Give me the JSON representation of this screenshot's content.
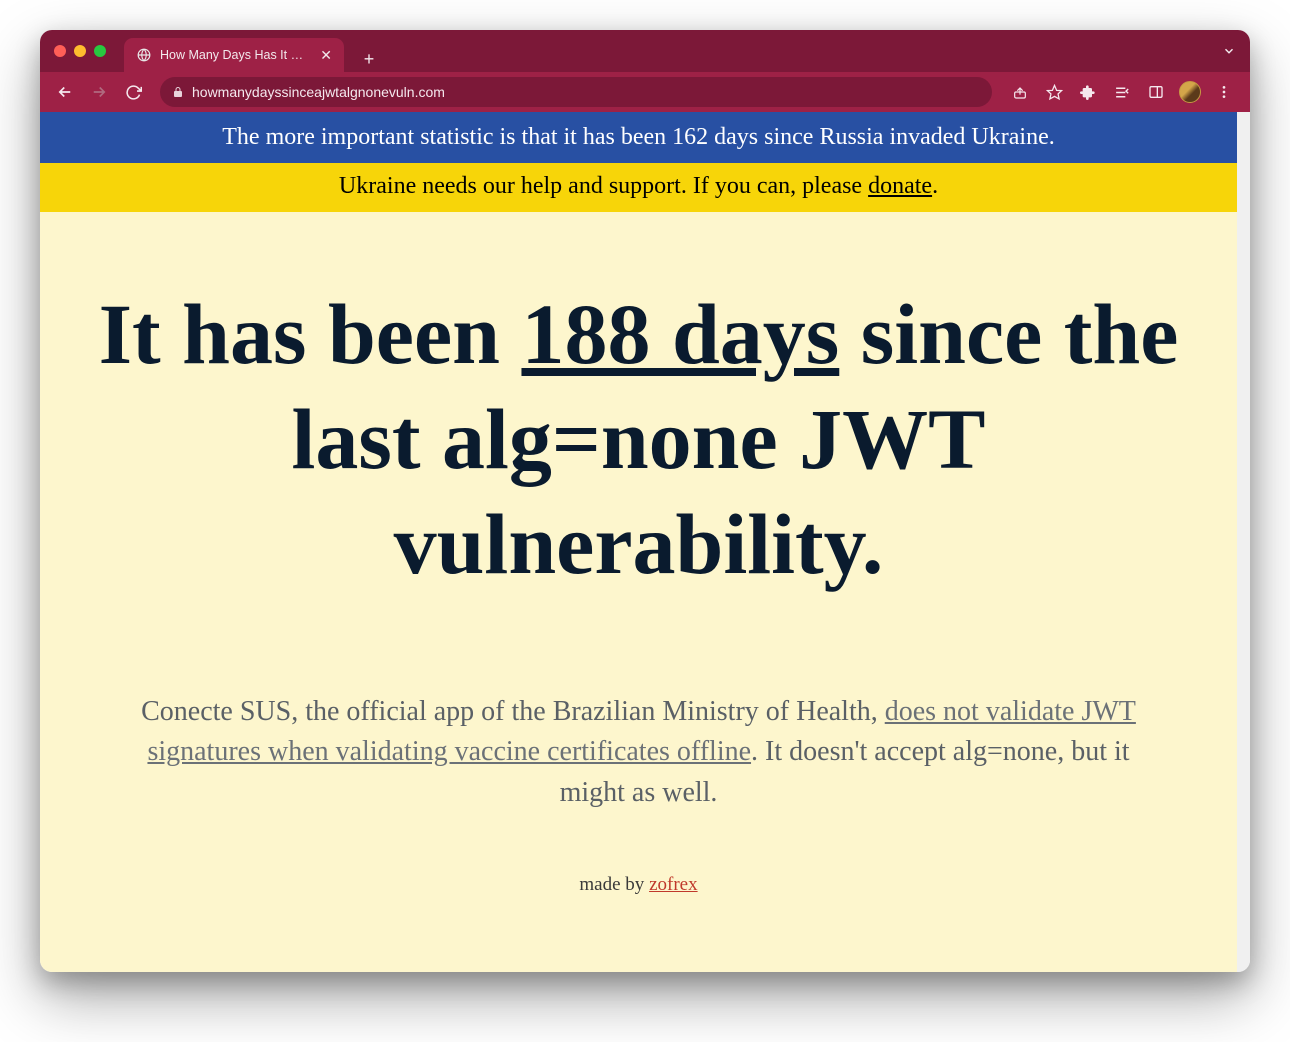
{
  "browser": {
    "tab_title": "How Many Days Has It Been Si",
    "url": "howmanydayssinceajwtalgnonevuln.com"
  },
  "banner": {
    "blue_text": "The more important statistic is that it has been 162 days since Russia invaded Ukraine.",
    "yellow_prefix": "Ukraine needs our help and support. If you can, please ",
    "yellow_link": "donate",
    "yellow_suffix": "."
  },
  "headline": {
    "prefix": "It has been ",
    "days": "188 days",
    "suffix": " since the last alg=none JWT vulnerability."
  },
  "description": {
    "part1": "Conecte SUS, the official app of the Brazilian Ministry of Health, ",
    "link": "does not validate JWT signatures when validating vaccine certificates offline",
    "part2": ". It doesn't accept alg=none, but it might as well."
  },
  "credit": {
    "prefix": "made by ",
    "author": "zofrex"
  }
}
